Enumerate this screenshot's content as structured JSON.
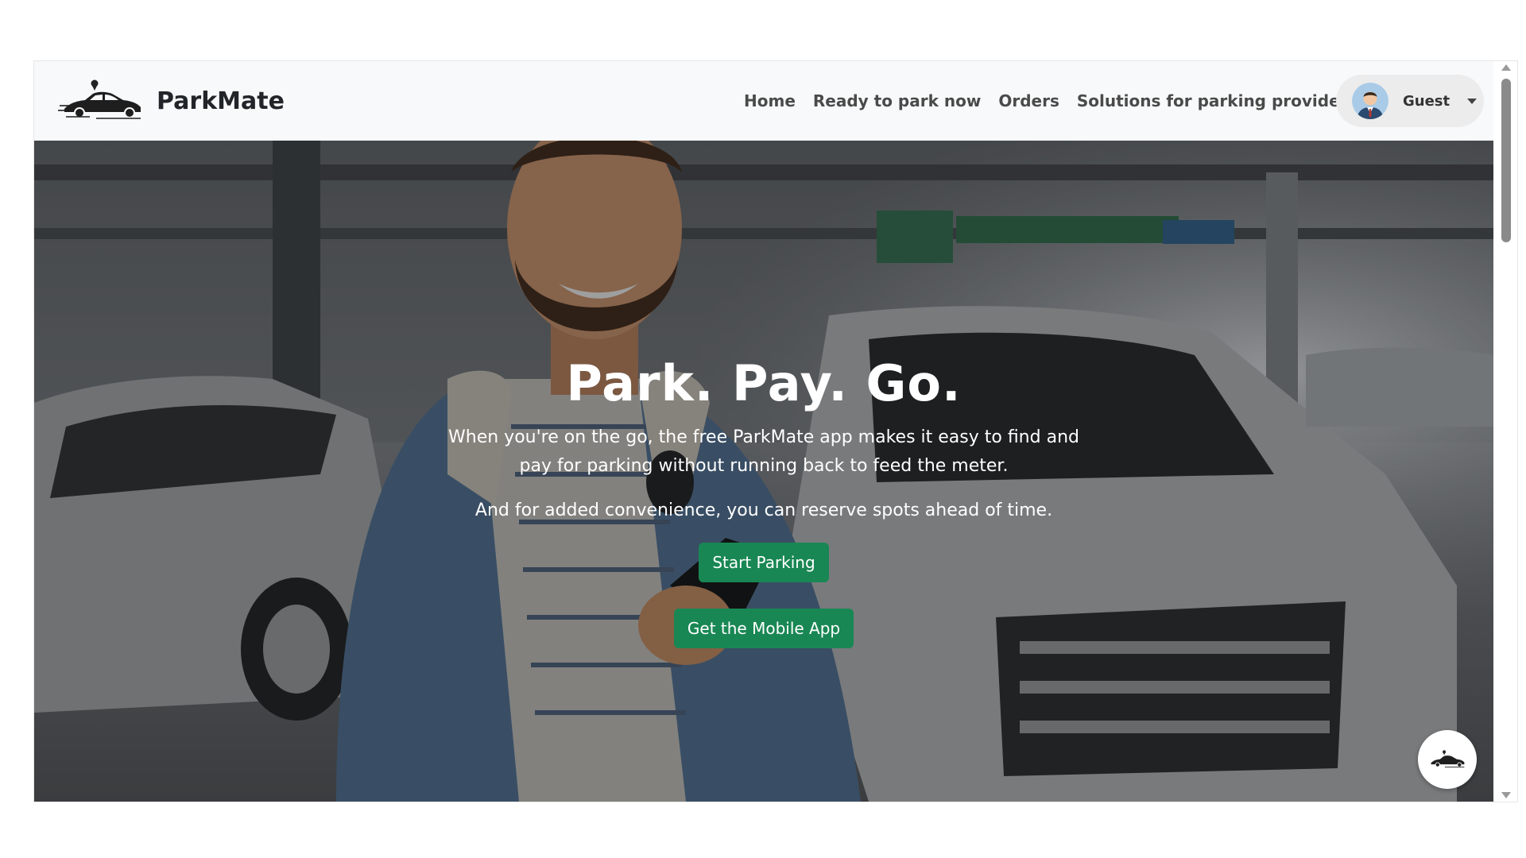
{
  "brand": {
    "name": "ParkMate",
    "logo_icon": "car-with-pin-logo"
  },
  "nav": {
    "items": [
      {
        "label": "Home"
      },
      {
        "label": "Ready to park now"
      },
      {
        "label": "Orders"
      },
      {
        "label": "Solutions for parking providers"
      }
    ]
  },
  "user": {
    "name": "Guest",
    "avatar_icon": "user-avatar-icon",
    "menu_icon": "caret-down-icon"
  },
  "hero": {
    "title": "Park. Pay. Go.",
    "text_1": "When you're on the go, the free ParkMate app makes it easy to find and pay for parking without running back to feed the meter.",
    "text_2": "And for added convenience, you can reserve spots ahead of time.",
    "primary_button": "Start Parking",
    "secondary_button": "Get the Mobile App",
    "background": "smiling man with phone in parking garage"
  },
  "floating_button": {
    "icon": "car-logo-icon"
  },
  "colors": {
    "navbar_bg": "#f8f9fa",
    "button_green": "#198754",
    "text_dark": "#212529"
  }
}
